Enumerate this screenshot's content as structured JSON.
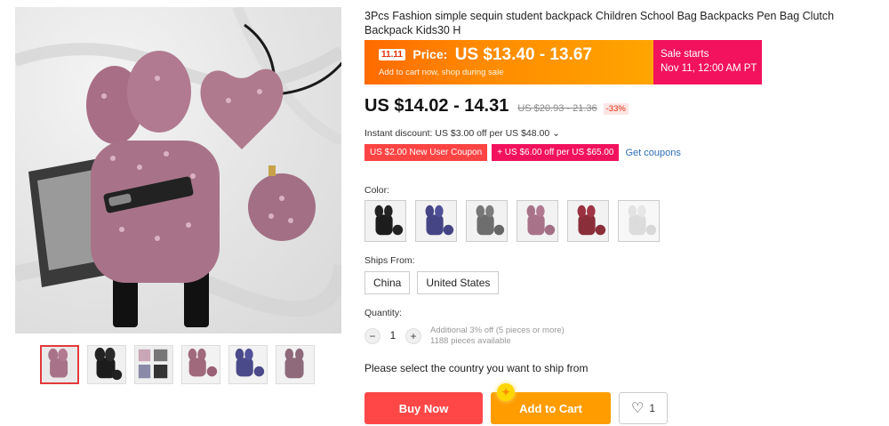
{
  "product": {
    "title": "3Pcs Fashion simple sequin student backpack Children School Bag Backpacks Pen Bag Clutch Backpack Kids30 H"
  },
  "gallery": {
    "thumbnails": [
      "thumb-1",
      "thumb-2",
      "thumb-3",
      "thumb-4",
      "thumb-5",
      "thumb-6"
    ],
    "active_index": 0
  },
  "promo": {
    "badge": "11.11",
    "price_label": "Price:",
    "price": "US $13.40 - 13.67",
    "subtext": "Add to cart now, shop during sale",
    "sale_title": "Sale starts",
    "sale_date": "Nov 11, 12:00 AM PT",
    "colors": {
      "orange": "#ff7a00",
      "pink": "#f2125e"
    }
  },
  "pricing": {
    "current": "US $14.02 - 14.31",
    "original": "US $20.93 - 21.36",
    "discount": "-33%"
  },
  "instant_discount": "Instant discount: US $3.00 off per US $48.00 ⌄",
  "coupons": {
    "new_user": "US $2.00 New User Coupon",
    "bulk": "+ US $6.00 off per US $65.00",
    "get_label": "Get coupons"
  },
  "color": {
    "label": "Color:",
    "swatches": [
      "black",
      "blue",
      "silver",
      "pink",
      "red",
      "white"
    ]
  },
  "ships_from": {
    "label": "Ships From:",
    "options": [
      "China",
      "United States"
    ]
  },
  "quantity": {
    "label": "Quantity:",
    "minus": "−",
    "value": "1",
    "plus": "+",
    "note_line1": "Additional 3% off (5 pieces or more)",
    "note_line2": "1188 pieces available"
  },
  "ship_message": "Please select the country you want to ship from",
  "actions": {
    "buy_now": "Buy Now",
    "add_to_cart": "Add to Cart",
    "wishlist_count": "1"
  }
}
